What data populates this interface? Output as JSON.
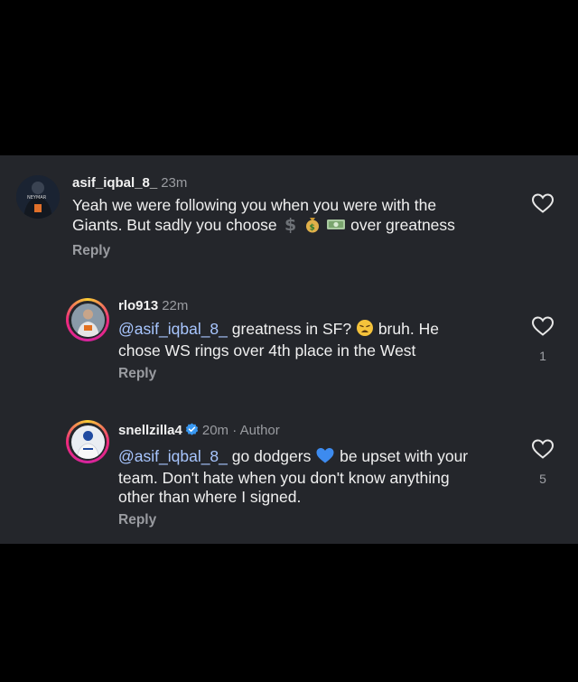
{
  "comments": [
    {
      "username": "asif_iqbal_8_",
      "time": "23m",
      "line1": "Yeah we were following you when you were with the",
      "line2_pre": "Giants. But sadly you choose",
      "line2_post": "over greatness",
      "emoji_icons": [
        "heavy-dollar-sign-icon",
        "money-bag-icon",
        "money-bills-icon"
      ],
      "reply_label": "Reply"
    },
    {
      "username": "rlo913",
      "time": "22m",
      "mention": "@asif_iqbal_8_",
      "line1_rest": "greatness in SF?",
      "line1_tail": "bruh. He",
      "line2": "chose WS rings over 4th place in the West",
      "emoji_icon": "weary-face-icon",
      "likes": "1",
      "reply_label": "Reply"
    },
    {
      "username": "snellzilla4",
      "time": "20m",
      "separator": "·",
      "author_label": "Author",
      "mention": "@asif_iqbal_8_",
      "line1_rest": "go dodgers",
      "line1_tail": "be upset with your",
      "line2": "team. Don't hate when you don't know anything",
      "line3": "other than where I signed.",
      "emoji_icon": "blue-heart-icon",
      "likes": "5",
      "reply_label": "Reply"
    }
  ],
  "colors": {
    "panel": "#24262b",
    "mention": "#a8c6ff",
    "muted": "#9a9ca1",
    "verified": "#3897f0"
  }
}
